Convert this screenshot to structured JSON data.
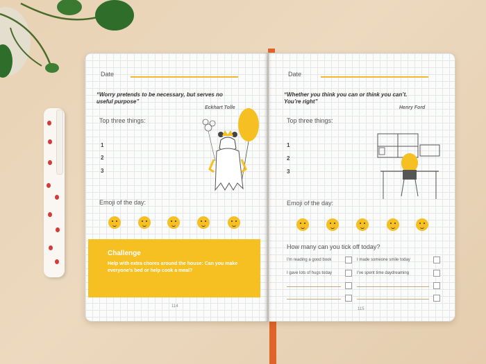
{
  "left_page": {
    "date_label": "Date",
    "quote": "“Worry pretends to be necessary, but serves no useful purpose”",
    "author": "Eckhart Tolle",
    "top_three_label": "Top three things:",
    "numbers": [
      "1",
      "2",
      "3"
    ],
    "emoji_label": "Emoji of the day:",
    "challenge_title": "Challenge",
    "challenge_text": "Help with extra chores around the house: Can you make everyone’s bed or help cook a meal?",
    "page_number": "114"
  },
  "right_page": {
    "date_label": "Date",
    "quote": "“Whether you think you can or think you can’t. You’re right”",
    "author": "Henry Ford",
    "top_three_label": "Top three things:",
    "numbers": [
      "1",
      "2",
      "3"
    ],
    "emoji_label": "Emoji of the day:",
    "tick_title": "How many can you tick off today?",
    "ticks": [
      "I’m reading a good book",
      "I made someone smile today",
      "I gave lots of hugs today",
      "I’ve spent time daydreaming"
    ],
    "page_number": "115"
  },
  "colors": {
    "accent_yellow": "#f6bf22",
    "pen_red": "#d33b3b",
    "bookmark": "#e0642a",
    "desk": "#e8d2b4"
  }
}
